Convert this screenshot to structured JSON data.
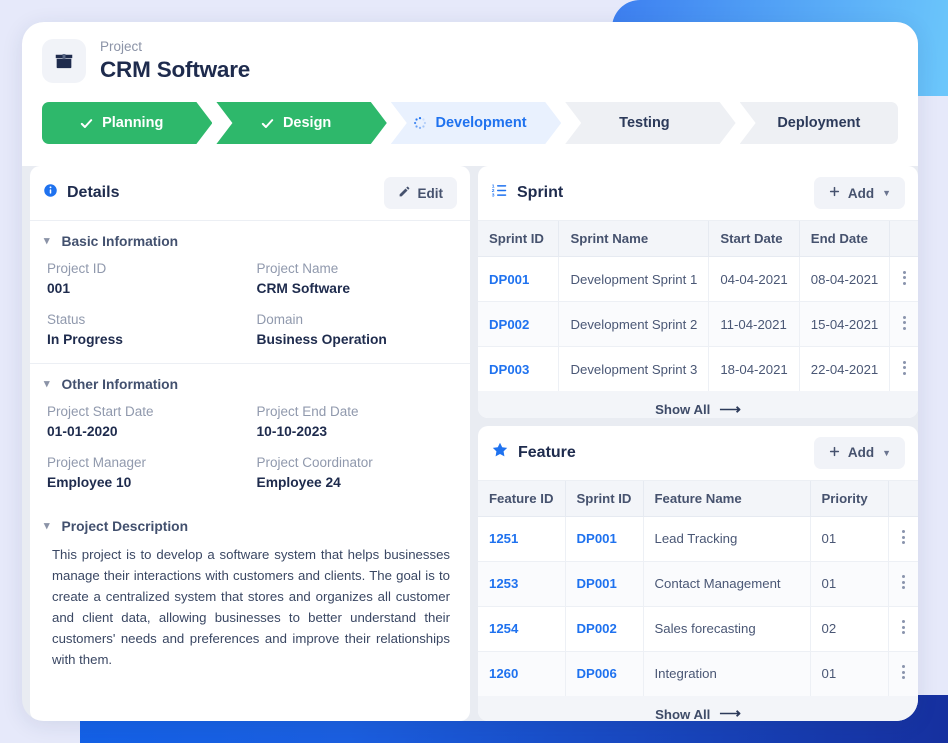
{
  "header": {
    "project_label": "Project",
    "project_title": "CRM Software",
    "project_icon": "archive-box-icon"
  },
  "steps": [
    {
      "label": "Planning",
      "state": "done",
      "icon": "check-icon"
    },
    {
      "label": "Design",
      "state": "done",
      "icon": "check-icon"
    },
    {
      "label": "Development",
      "state": "current",
      "icon": "spinner-icon"
    },
    {
      "label": "Testing",
      "state": "todo",
      "icon": ""
    },
    {
      "label": "Deployment",
      "state": "todo",
      "icon": ""
    }
  ],
  "details": {
    "title": "Details",
    "title_icon": "info-icon",
    "edit_label": "Edit",
    "edit_icon": "pencil-icon",
    "sections": [
      {
        "heading": "Basic Information",
        "fields": [
          {
            "key": "Project ID",
            "value": "001"
          },
          {
            "key": "Project Name",
            "value": "CRM Software"
          },
          {
            "key": "Status",
            "value": "In Progress"
          },
          {
            "key": "Domain",
            "value": "Business Operation"
          }
        ]
      },
      {
        "heading": "Other Information",
        "fields": [
          {
            "key": "Project Start Date",
            "value": "01-01-2020"
          },
          {
            "key": "Project End Date",
            "value": "10-10-2023"
          },
          {
            "key": "Project Manager",
            "value": "Employee 10"
          },
          {
            "key": "Project Coordinator",
            "value": "Employee 24"
          }
        ]
      }
    ],
    "description_heading": "Project Description",
    "description": "This project is to develop a software system that helps businesses manage their interactions with customers and clients. The goal is to create a centralized system that stores and organizes all customer and client data, allowing businesses to better understand their customers' needs and preferences and improve their relationships with them."
  },
  "sprint": {
    "title": "Sprint",
    "title_icon": "ordered-list-icon",
    "add_label": "Add",
    "add_icon": "plus-icon",
    "caret_icon": "chevron-down-icon",
    "columns": [
      "Sprint ID",
      "Sprint Name",
      "Start Date",
      "End Date"
    ],
    "rows": [
      {
        "id": "DP001",
        "name": "Development Sprint 1",
        "start": "04-04-2021",
        "end": "08-04-2021"
      },
      {
        "id": "DP002",
        "name": "Development Sprint 2",
        "start": "11-04-2021",
        "end": "15-04-2021"
      },
      {
        "id": "DP003",
        "name": "Development Sprint 3",
        "start": "18-04-2021",
        "end": "22-04-2021"
      }
    ],
    "show_all": "Show All"
  },
  "feature": {
    "title": "Feature",
    "title_icon": "star-icon",
    "add_label": "Add",
    "add_icon": "plus-icon",
    "caret_icon": "chevron-down-icon",
    "columns": [
      "Feature ID",
      "Sprint ID",
      "Feature Name",
      "Priority"
    ],
    "rows": [
      {
        "fid": "1251",
        "sid": "DP001",
        "name": "Lead Tracking",
        "priority": "01"
      },
      {
        "fid": "1253",
        "sid": "DP001",
        "name": "Contact Management",
        "priority": "01"
      },
      {
        "fid": "1254",
        "sid": "DP002",
        "name": "Sales forecasting",
        "priority": "02"
      },
      {
        "fid": "1260",
        "sid": "DP006",
        "name": "Integration",
        "priority": "01"
      }
    ],
    "show_all": "Show All"
  },
  "colors": {
    "done": "#2eb86b",
    "current_text": "#1f72ef",
    "current_bg": "#e9f1fe",
    "todo_bg": "#eef0f4",
    "link": "#1f72ef",
    "heading": "#1e2b4d",
    "muted": "#9099ad",
    "page_bg": "#e6e9fa"
  }
}
